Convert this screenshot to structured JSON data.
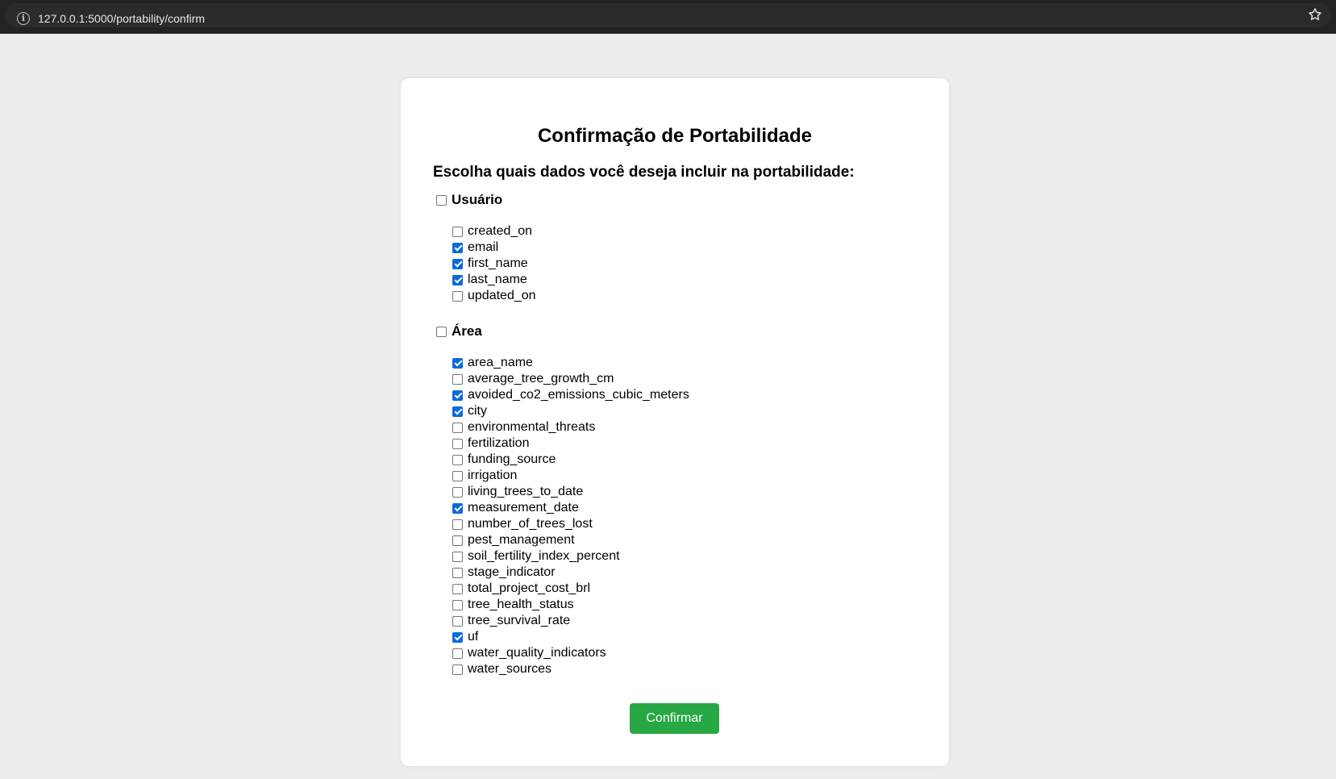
{
  "browser": {
    "url": "127.0.0.1:5000/portability/confirm"
  },
  "page": {
    "title": "Confirmação de Portabilidade",
    "subtitle": "Escolha quais dados você deseja incluir na portabilidade:"
  },
  "groups": [
    {
      "label": "Usuário",
      "checked": false,
      "fields": [
        {
          "name": "created_on",
          "checked": false
        },
        {
          "name": "email",
          "checked": true
        },
        {
          "name": "first_name",
          "checked": true
        },
        {
          "name": "last_name",
          "checked": true
        },
        {
          "name": "updated_on",
          "checked": false
        }
      ]
    },
    {
      "label": "Área",
      "checked": false,
      "fields": [
        {
          "name": "area_name",
          "checked": true
        },
        {
          "name": "average_tree_growth_cm",
          "checked": false
        },
        {
          "name": "avoided_co2_emissions_cubic_meters",
          "checked": true
        },
        {
          "name": "city",
          "checked": true
        },
        {
          "name": "environmental_threats",
          "checked": false
        },
        {
          "name": "fertilization",
          "checked": false
        },
        {
          "name": "funding_source",
          "checked": false
        },
        {
          "name": "irrigation",
          "checked": false
        },
        {
          "name": "living_trees_to_date",
          "checked": false
        },
        {
          "name": "measurement_date",
          "checked": true
        },
        {
          "name": "number_of_trees_lost",
          "checked": false
        },
        {
          "name": "pest_management",
          "checked": false
        },
        {
          "name": "soil_fertility_index_percent",
          "checked": false
        },
        {
          "name": "stage_indicator",
          "checked": false
        },
        {
          "name": "total_project_cost_brl",
          "checked": false
        },
        {
          "name": "tree_health_status",
          "checked": false
        },
        {
          "name": "tree_survival_rate",
          "checked": false
        },
        {
          "name": "uf",
          "checked": true
        },
        {
          "name": "water_quality_indicators",
          "checked": false
        },
        {
          "name": "water_sources",
          "checked": false
        }
      ]
    }
  ],
  "actions": {
    "confirm_label": "Confirmar"
  },
  "colors": {
    "background": "#ededed",
    "card": "#ffffff",
    "confirm_button": "#28a745",
    "checkbox_checked": "#0b6bd8"
  }
}
